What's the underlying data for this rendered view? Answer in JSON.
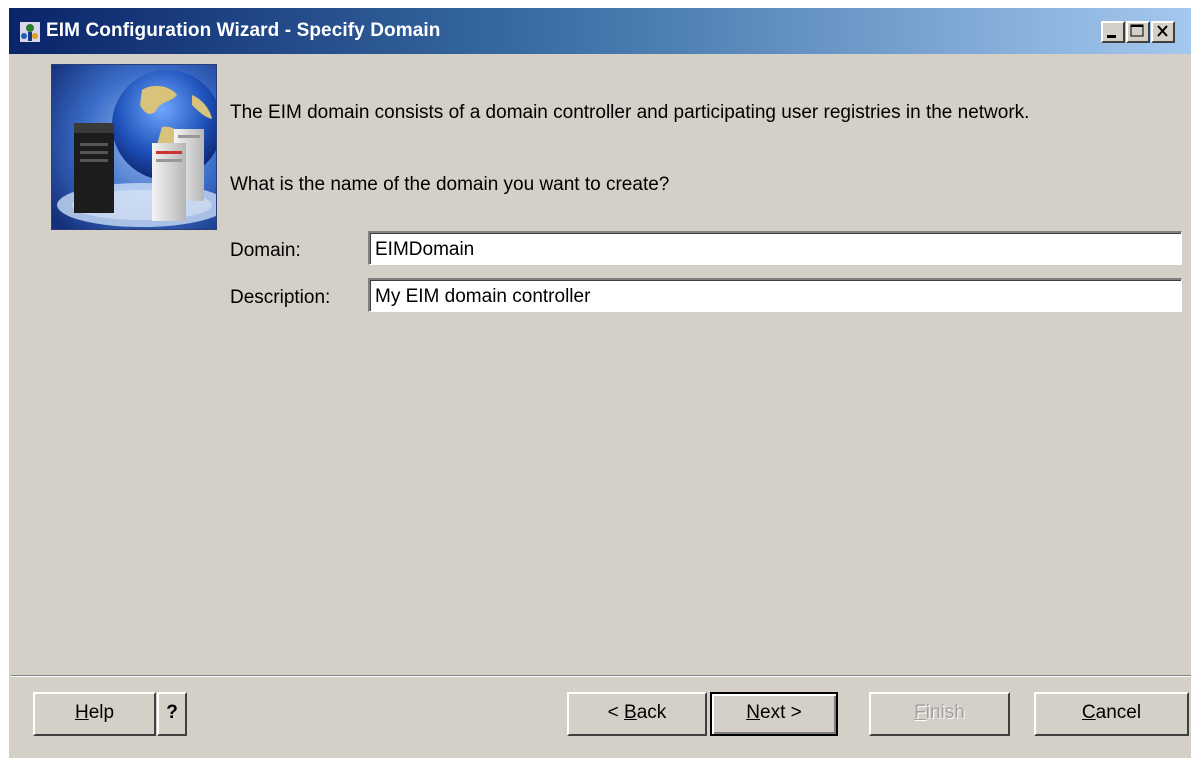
{
  "window": {
    "title": "EIM Configuration Wizard - Specify Domain",
    "controls": [
      "minimize",
      "maximize",
      "close"
    ]
  },
  "intro": {
    "description": "The EIM domain consists of a domain controller and participating user registries in the network.",
    "question": "What is the name of the domain you want to create?"
  },
  "form": {
    "domain_label": "Domain:",
    "domain_value": "EIMDomain",
    "description_label": "Description:",
    "description_value": "My EIM domain controller"
  },
  "buttons": {
    "help": {
      "mnemonic": "H",
      "rest": "elp"
    },
    "help_question": "?",
    "back": {
      "prefix": "< ",
      "mnemonic": "B",
      "rest": "ack"
    },
    "next": {
      "mnemonic": "N",
      "rest": "ext >"
    },
    "finish": {
      "mnemonic": "F",
      "rest": "inish",
      "enabled": false
    },
    "cancel": {
      "mnemonic": "C",
      "rest": "ancel"
    }
  },
  "colors": {
    "title_gradient_start": "#0a246a",
    "title_gradient_end": "#a6caf0",
    "dialog_face": "#d4d0c8"
  }
}
